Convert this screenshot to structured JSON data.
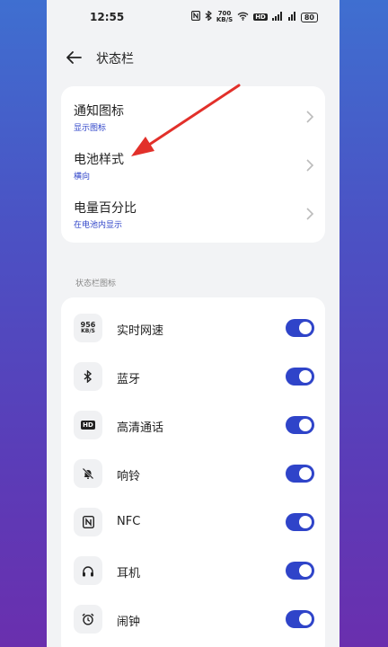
{
  "statusbar": {
    "time": "12:55",
    "speed_value": "700",
    "speed_unit": "KB/S",
    "hd_label": "HD",
    "battery": "80"
  },
  "header": {
    "title": "状态栏"
  },
  "settings": [
    {
      "title": "通知图标",
      "value": "显示图标"
    },
    {
      "title": "电池样式",
      "value": "横向"
    },
    {
      "title": "电量百分比",
      "value": "在电池内显示"
    }
  ],
  "section_title": "状态栏图标",
  "icon_items": [
    {
      "label": "实时网速",
      "icon": "network-speed-icon",
      "icon_text_top": "956",
      "icon_text_bottom": "KB/S",
      "enabled": true
    },
    {
      "label": "蓝牙",
      "icon": "bluetooth-icon",
      "enabled": true
    },
    {
      "label": "高清通话",
      "icon": "hd-call-icon",
      "icon_text": "HD",
      "enabled": true
    },
    {
      "label": "响铃",
      "icon": "bell-muted-icon",
      "enabled": true
    },
    {
      "label": "NFC",
      "icon": "nfc-icon",
      "enabled": true
    },
    {
      "label": "耳机",
      "icon": "headphones-icon",
      "enabled": true
    },
    {
      "label": "闹钟",
      "icon": "alarm-clock-icon",
      "enabled": true
    }
  ],
  "colors": {
    "accent": "#2f44c9",
    "arrow": "#e2302a",
    "background": "#f2f3f5"
  }
}
